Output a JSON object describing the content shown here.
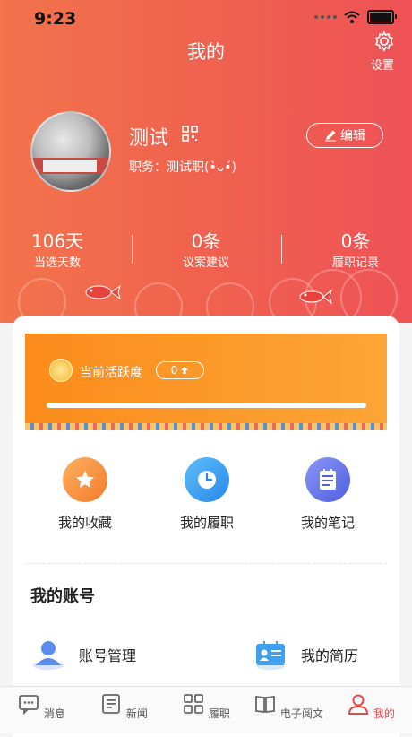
{
  "status_bar": {
    "time": "9:23"
  },
  "header": {
    "title": "我的",
    "settings_label": "设置"
  },
  "profile": {
    "name": "测试",
    "job": "职务：测试职(•̀ᴗ•́)",
    "edit_label": "编辑"
  },
  "stats": [
    {
      "value": "106天",
      "label": "当选天数"
    },
    {
      "value": "0条",
      "label": "议案建议"
    },
    {
      "value": "0条",
      "label": "履职记录"
    }
  ],
  "activity": {
    "label": "当前活跃度",
    "value": "0",
    "progress": 0
  },
  "quick_actions": [
    {
      "label": "我的收藏",
      "icon": "star-icon",
      "color": "#f58a3a"
    },
    {
      "label": "我的履职",
      "icon": "clock-icon",
      "color": "#3a9cf0"
    },
    {
      "label": "我的笔记",
      "icon": "notepad-icon",
      "color": "#5b6ee8"
    }
  ],
  "account": {
    "title": "我的账号",
    "items": [
      {
        "label": "账号管理",
        "icon": "user-icon"
      },
      {
        "label": "我的简历",
        "icon": "resume-icon"
      }
    ]
  },
  "tabbar": [
    {
      "label": "消息",
      "icon": "message-icon",
      "active": false
    },
    {
      "label": "新闻",
      "icon": "news-icon",
      "active": false
    },
    {
      "label": "履职",
      "icon": "grid-icon",
      "active": false
    },
    {
      "label": "电子阅文",
      "icon": "book-icon",
      "active": false
    },
    {
      "label": "我的",
      "icon": "person-icon",
      "active": true
    }
  ],
  "colors": {
    "primary": "#f0604f",
    "accent_orange": "#fb8c1b",
    "tab_active": "#e8484b"
  }
}
